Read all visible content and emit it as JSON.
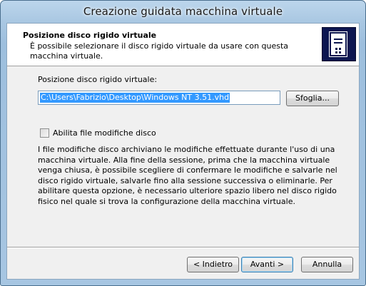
{
  "window": {
    "title": "Creazione guidata macchina virtuale"
  },
  "header": {
    "title": "Posizione disco rigido virtuale",
    "description": "È possibile selezionare il disco rigido virtuale da usare con questa macchina virtuale.",
    "icon": "hard-disk-icon"
  },
  "form": {
    "path_label": "Posizione disco rigido virtuale:",
    "path_value": "C:\\Users\\Fabrizio\\Desktop\\Windows NT 3.51.vhd",
    "browse_label": "Sfoglia...",
    "checkbox_label": "Abilita file modifiche disco",
    "checkbox_checked": false,
    "info": "I file modifiche disco archiviano le modifiche effettuate durante l'uso di una macchina virtuale. Alla fine della sessione, prima che la macchina virtuale venga chiusa, è possibile scegliere di confermare le modifiche e salvarle nel disco rigido virtuale, salvarle fino alla sessione successiva o eliminarle. Per abilitare questa opzione, è necessario ulteriore spazio libero nel disco rigido fisico nel quale si trova la configurazione della macchina virtuale."
  },
  "footer": {
    "back_label": "< Indietro",
    "next_label": "Avanti >",
    "cancel_label": "Annulla"
  }
}
